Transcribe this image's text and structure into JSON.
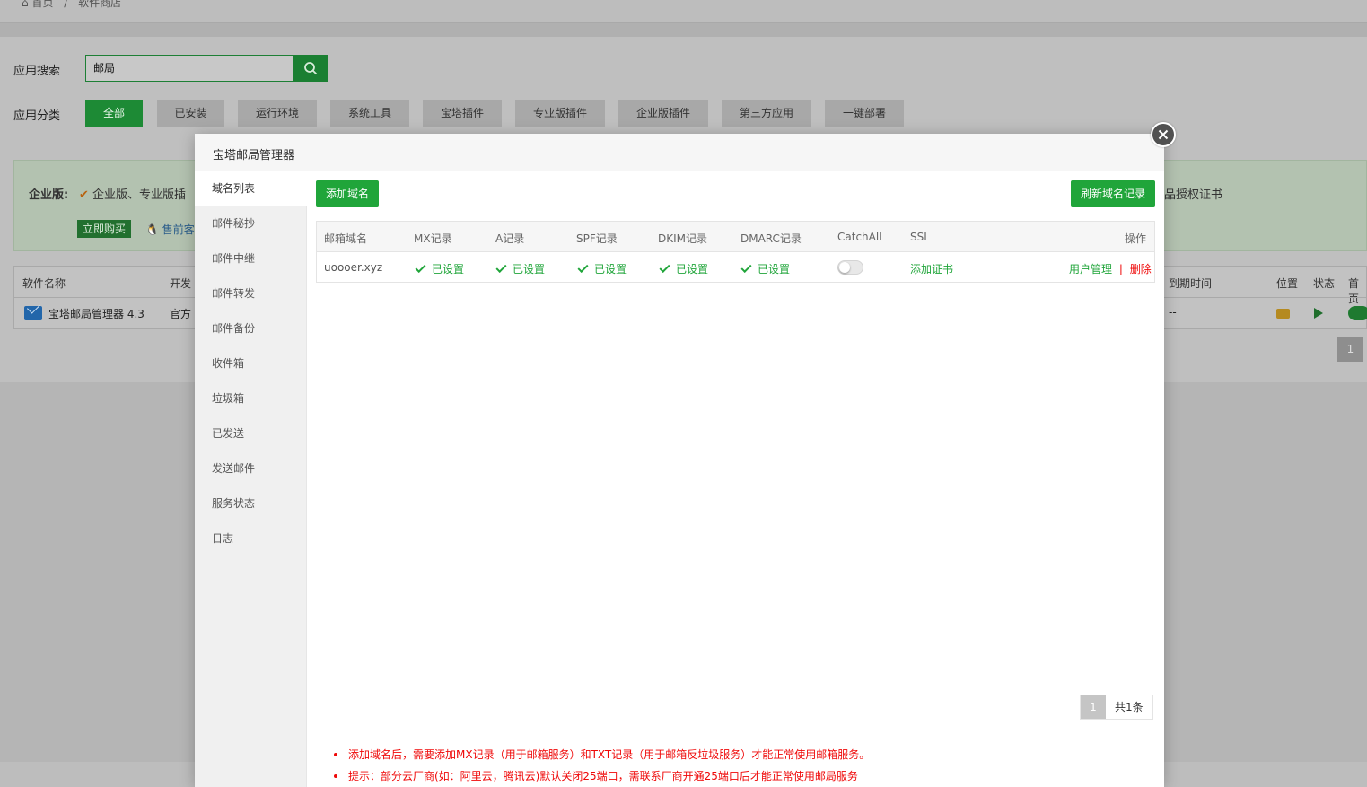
{
  "breadcrumb": {
    "home": "首页",
    "separator": "/",
    "current": "软件商店"
  },
  "search": {
    "label": "应用搜索",
    "value": "邮局"
  },
  "categories": {
    "label": "应用分类",
    "items": [
      "全部",
      "已安装",
      "运行环境",
      "系统工具",
      "宝塔插件",
      "专业版插件",
      "企业版插件",
      "第三方应用",
      "一键部署"
    ]
  },
  "promo": {
    "title": "企业版:",
    "features": "企业版、专业版插",
    "buy_label": "立即购买",
    "presale_label": "售前客",
    "cert_fragment": "品授权证书"
  },
  "software_table": {
    "headers": {
      "name": "软件名称",
      "dev": "开发",
      "expire": "到期时间",
      "position": "位置",
      "status": "状态",
      "home": "首页"
    },
    "row": {
      "name": "宝塔邮局管理器 4.3",
      "dev": "官方",
      "expire": "--"
    }
  },
  "bg_pagination": {
    "current": "1"
  },
  "modal": {
    "title": "宝塔邮局管理器",
    "sidebar": [
      "域名列表",
      "邮件秘抄",
      "邮件中继",
      "邮件转发",
      "邮件备份",
      "收件箱",
      "垃圾箱",
      "已发送",
      "发送邮件",
      "服务状态",
      "日志"
    ],
    "add_domain_label": "添加域名",
    "refresh_label": "刷新域名记录",
    "table": {
      "headers": [
        "邮箱域名",
        "MX记录",
        "A记录",
        "SPF记录",
        "DKIM记录",
        "DMARC记录",
        "CatchAll",
        "SSL",
        "操作"
      ],
      "rows": [
        {
          "domain": "uoooer.xyz",
          "mx": "已设置",
          "a": "已设置",
          "spf": "已设置",
          "dkim": "已设置",
          "dmarc": "已设置",
          "catchall": false,
          "ssl": "添加证书",
          "user_manage": "用户管理",
          "separator": "|",
          "delete": "删除"
        }
      ]
    },
    "pagination": {
      "current": "1",
      "total": "共1条"
    },
    "tips": [
      "添加域名后，需要添加MX记录（用于邮箱服务）和TXT记录（用于邮箱反垃圾服务）才能正常使用邮箱服务。",
      "提示：部分云厂商(如：阿里云，腾讯云)默认关闭25端口，需联系厂商开通25端口后才能正常使用邮局服务"
    ]
  },
  "colors": {
    "green": "#20a53a",
    "red": "#ef0808"
  }
}
